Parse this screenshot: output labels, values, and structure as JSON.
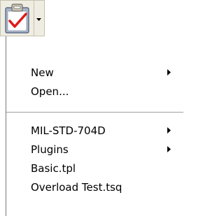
{
  "toolbar": {
    "main_icon": "clipboard-checkmark-icon",
    "dropdown_icon": "dropdown-arrow-icon"
  },
  "menu": {
    "items": [
      {
        "label": "New",
        "has_submenu": true
      },
      {
        "label": "Open...",
        "has_submenu": false
      },
      {
        "label": "MIL-STD-704D",
        "has_submenu": true
      },
      {
        "label": "Plugins",
        "has_submenu": true
      },
      {
        "label": "Basic.tpl",
        "has_submenu": false
      },
      {
        "label": "Overload Test.tsq",
        "has_submenu": false
      }
    ]
  }
}
